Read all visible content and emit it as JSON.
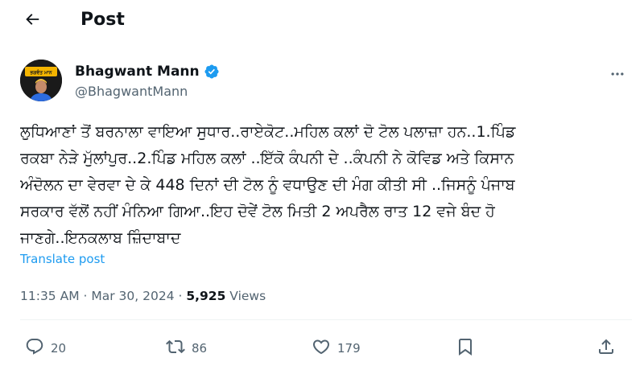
{
  "header": {
    "back_icon": "arrow-left-icon",
    "title": "Post"
  },
  "author": {
    "avatar_icon": "profile-avatar",
    "avatar_text": "ਭਗਵੰਤ ਮਾਨ",
    "name": "Bhagwant Mann",
    "verified_icon": "verified-badge-icon",
    "verified_color": "#1d9bf0",
    "handle": "@BhagwantMann",
    "more_icon": "more-horizontal-icon"
  },
  "tweet": {
    "lines": [
      "ਲੁਧਿਆਣਾਂ ਤੋਂ ਬਰਨਾਲਾ ਵਾਇਆ ਸੁਧਾਰ..ਰਾਏਕੋਟ..ਮਹਿਲ ਕਲਾਂ ਦੋ ਟੋਲ ਪਲਾਜ਼ਾ ਹਨ..1.ਪਿੰਡ",
      "ਰਕਬਾ ਨੇੜੇ ਮੁੱਲਾਂਪੁਰ..2.ਪਿੰਡ ਮਹਿਲ ਕਲਾਂ ..ਇੱਕੋ ਕੰਪਨੀ ਦੇ ..ਕੰਪਨੀ ਨੇ ਕੋਵਿਡ ਅਤੇ ਕਿਸਾਨ",
      "ਅੰਦੋਲਨ ਦਾ ਵੇਰਵਾ ਦੇ ਕੇ 448 ਦਿਨਾਂ ਦੀ ਟੋਲ ਨੂੰ ਵਧਾਉਣ ਦੀ ਮੰਗ ਕੀਤੀ ਸੀ ..ਜਿਸਨੂੰ ਪੰਜਾਬ",
      "ਸਰਕਾਰ ਵੱਲੋਂ ਨਹੀਂ ਮੰਨਿਆ ਗਿਆ..ਇਹ ਦੋਵੇਂ ਟੋਲ ਮਿਤੀ 2 ਅਪਰੈਲ ਰਾਤ 12 ਵਜੇ ਬੰਦ ਹੋ",
      "ਜਾਣਗੇ..ਇਨਕਲਾਬ ਜ਼ਿੰਦਾਬਾਦ"
    ],
    "translate_label": "Translate post"
  },
  "meta": {
    "time": "11:35 AM",
    "separator": " · ",
    "date": "Mar 30, 2024",
    "views_count": "5,925",
    "views_label": " Views"
  },
  "actions": {
    "reply": {
      "icon": "reply-icon",
      "count": "20"
    },
    "repost": {
      "icon": "repost-icon",
      "count": "86"
    },
    "like": {
      "icon": "heart-icon",
      "count": "179"
    },
    "bookmark": {
      "icon": "bookmark-icon"
    },
    "share": {
      "icon": "share-icon"
    }
  },
  "colors": {
    "text_primary": "#0f1419",
    "text_secondary": "#536471",
    "accent": "#1d9bf0",
    "divider": "#eff3f4"
  }
}
